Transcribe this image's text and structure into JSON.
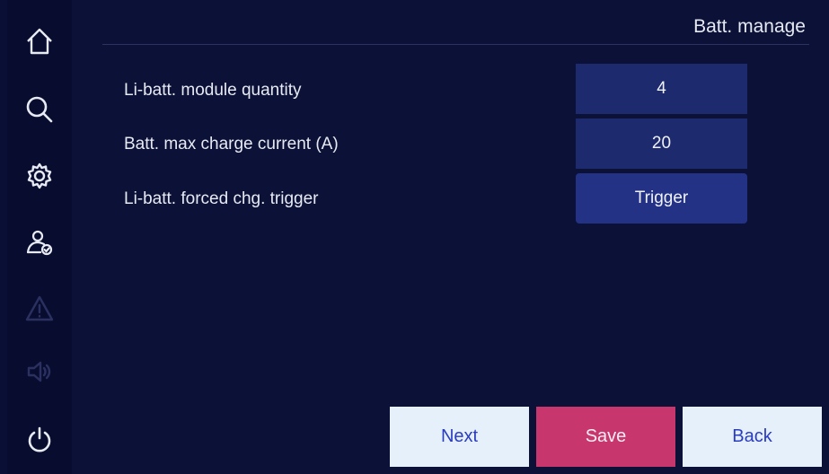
{
  "header": {
    "title": "Batt. manage"
  },
  "sidebar": {
    "items": [
      {
        "icon": "home-icon"
      },
      {
        "icon": "search-icon"
      },
      {
        "icon": "gear-icon"
      },
      {
        "icon": "user-check-icon"
      },
      {
        "icon": "warning-icon"
      },
      {
        "icon": "speaker-icon"
      },
      {
        "icon": "power-icon"
      }
    ]
  },
  "settings": [
    {
      "label": "Li-batt. module quantity",
      "value": "4"
    },
    {
      "label": "Batt. max charge current (A)",
      "value": "20"
    },
    {
      "label": "Li-batt. forced chg. trigger",
      "value": "Trigger"
    }
  ],
  "footer": {
    "next_label": "Next",
    "save_label": "Save",
    "back_label": "Back"
  },
  "colors": {
    "background": "#0b1137",
    "value_box": "#1e2a6e",
    "trigger_button": "#243286",
    "save_button": "#c8366e",
    "nav_button": "#e6f0fb"
  }
}
